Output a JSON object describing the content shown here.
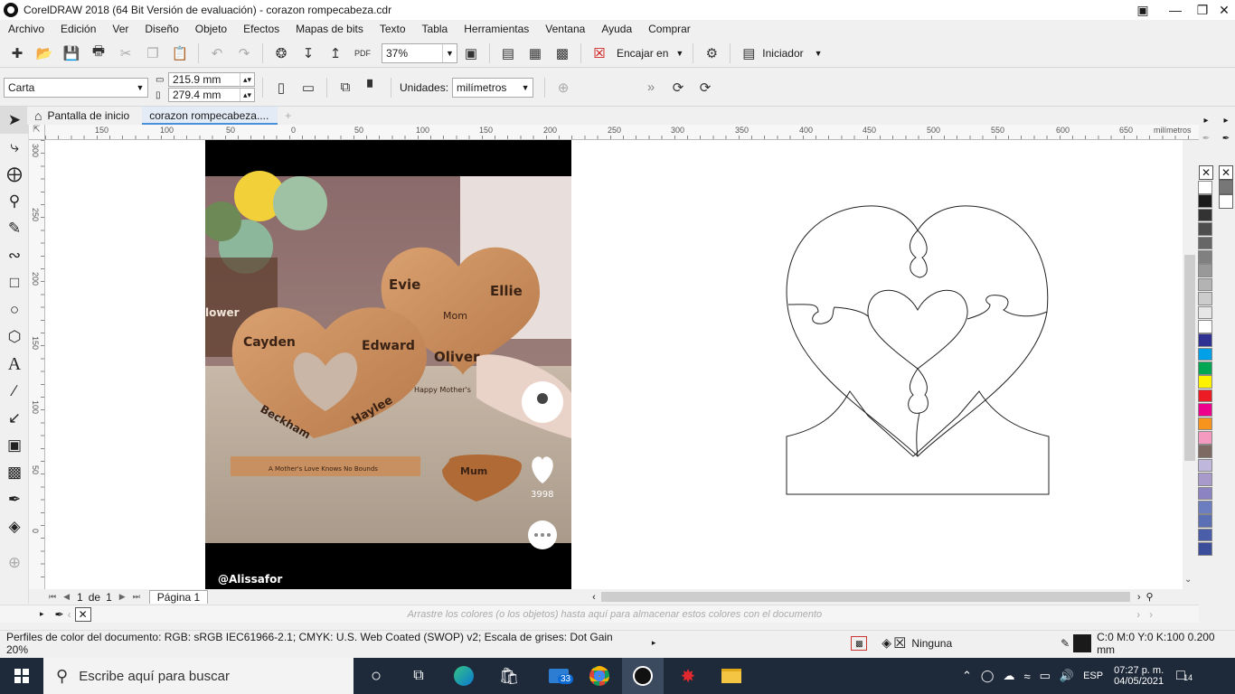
{
  "window": {
    "title": "CorelDRAW 2018 (64 Bit Versión de evaluación) - corazon rompecabeza.cdr",
    "buttons": [
      "▣",
      "—",
      "❐",
      "✕"
    ]
  },
  "menu": [
    "Archivo",
    "Edición",
    "Ver",
    "Diseño",
    "Objeto",
    "Efectos",
    "Mapas de bits",
    "Texto",
    "Tabla",
    "Herramientas",
    "Ventana",
    "Ayuda",
    "Comprar"
  ],
  "toolbar": {
    "zoom": "37%",
    "snap_label": "Encajar en",
    "launcher_label": "Iniciador"
  },
  "property_bar": {
    "page_size": "Carta",
    "width": "215.9 mm",
    "height": "279.4 mm",
    "units_label": "Unidades:",
    "units_value": "milímetros"
  },
  "tabs": {
    "home": "Pantalla de inicio",
    "document": "corazon rompecabeza....",
    "add": "+"
  },
  "ruler": {
    "h_ticks": [
      "150",
      "100",
      "50",
      "0",
      "50",
      "100",
      "150",
      "200",
      "250",
      "300",
      "350",
      "400",
      "450",
      "500",
      "550",
      "600",
      "650"
    ],
    "unit": "milímetros",
    "v_ticks": [
      "300",
      "250",
      "200",
      "150",
      "100",
      "50",
      "0"
    ]
  },
  "photo": {
    "names": [
      "Evie",
      "Ellie",
      "Mom",
      "Cayden",
      "Edward",
      "Oliver",
      "Beckham",
      "Haylee",
      "lower",
      "Happy Mother's",
      "A Mother's Love Knows No Bounds",
      "Mum"
    ],
    "like_count": "3998",
    "username": "@Alissafor"
  },
  "page_nav": {
    "current": "1",
    "of": "de",
    "total": "1",
    "page_tab": "Página 1"
  },
  "colorwell_hint": "Arrastre los colores (o los objetos) hasta aquí para almacenar estos colores con el documento",
  "status": {
    "color_profiles": "Perfiles de color del documento: RGB: sRGB IEC61966-2.1; CMYK: U.S. Web Coated (SWOP) v2; Escala de grises: Dot Gain 20%",
    "fill": "Ninguna",
    "outline": "C:0 M:0 Y:0 K:100  0.200 mm"
  },
  "palette": [
    "#ffffff",
    "#1a1a1a",
    "#333333",
    "#4d4d4d",
    "#666666",
    "#808080",
    "#999999",
    "#b3b3b3",
    "#cccccc",
    "#e6e6e6",
    "#ffffff",
    "#2e3192",
    "#00a0e9",
    "#00a651",
    "#fff200",
    "#ed1c24",
    "#ec008c",
    "#f7941d",
    "#f49ac1",
    "#7d6b63",
    "#bfb8dc",
    "#a89bcc",
    "#8c83c2",
    "#6c7ec0",
    "#5b6fb5",
    "#4a5da8",
    "#3a4e9c"
  ],
  "taskbar": {
    "search_placeholder": "Escribe aquí para buscar",
    "mail_badge": "33",
    "lang": "ESP",
    "time": "07:27 p. m.",
    "date": "04/05/2021",
    "notif": "14"
  }
}
